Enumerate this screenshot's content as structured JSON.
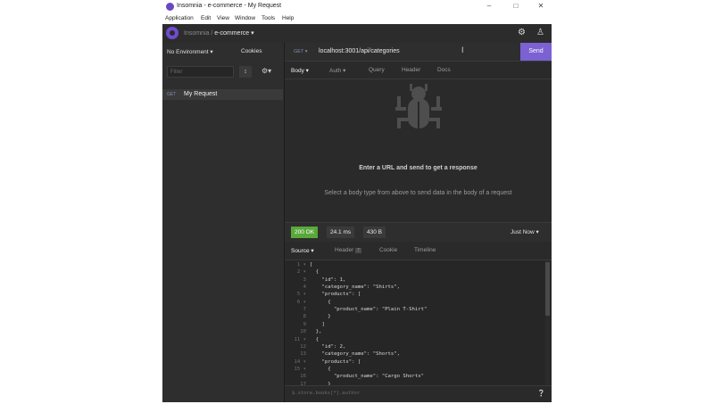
{
  "window": {
    "title": "Insomnia - e-commerce - My Request"
  },
  "menu": [
    "Application",
    "Edit",
    "View",
    "Window",
    "Tools",
    "Help"
  ],
  "appbar": {
    "workspace_parent": "Insomnia",
    "separator": "/",
    "workspace": "e-commerce"
  },
  "sidebar": {
    "environment": "No Environment",
    "cookies": "Cookies",
    "filter_placeholder": "Filter",
    "requests": [
      {
        "method": "GET",
        "name": "My Request"
      }
    ]
  },
  "request": {
    "method": "GET",
    "url": "localhost:3001/api/categories",
    "send_label": "Send",
    "tabs": [
      "Body",
      "Auth",
      "Query",
      "Header",
      "Docs"
    ],
    "empty_title": "Enter a URL and send to get a response",
    "empty_hint": "Select a body type from above to send data in the body of a request"
  },
  "response": {
    "status": "200 OK",
    "time": "24.1 ms",
    "size": "430 B",
    "timestamp": "Just Now",
    "tabs": [
      "Source",
      "Header",
      "Cookie",
      "Timeline"
    ],
    "header_count": "7",
    "filter_placeholder": "$.store.books[*].author",
    "lines": [
      "[",
      "  {",
      "    \"id\": 1,",
      "    \"category_name\": \"Shirts\",",
      "    \"products\": [",
      "      {",
      "        \"product_name\": \"Plain T-Shirt\"",
      "      }",
      "    ]",
      "  },",
      "  {",
      "    \"id\": 2,",
      "    \"category_name\": \"Shorts\",",
      "    \"products\": [",
      "      {",
      "        \"product_name\": \"Cargo Shorts\"",
      "      }"
    ]
  },
  "colors": {
    "accent": "#7b61d2",
    "ok": "#59a83a",
    "method_get": "#7e8fb0"
  }
}
